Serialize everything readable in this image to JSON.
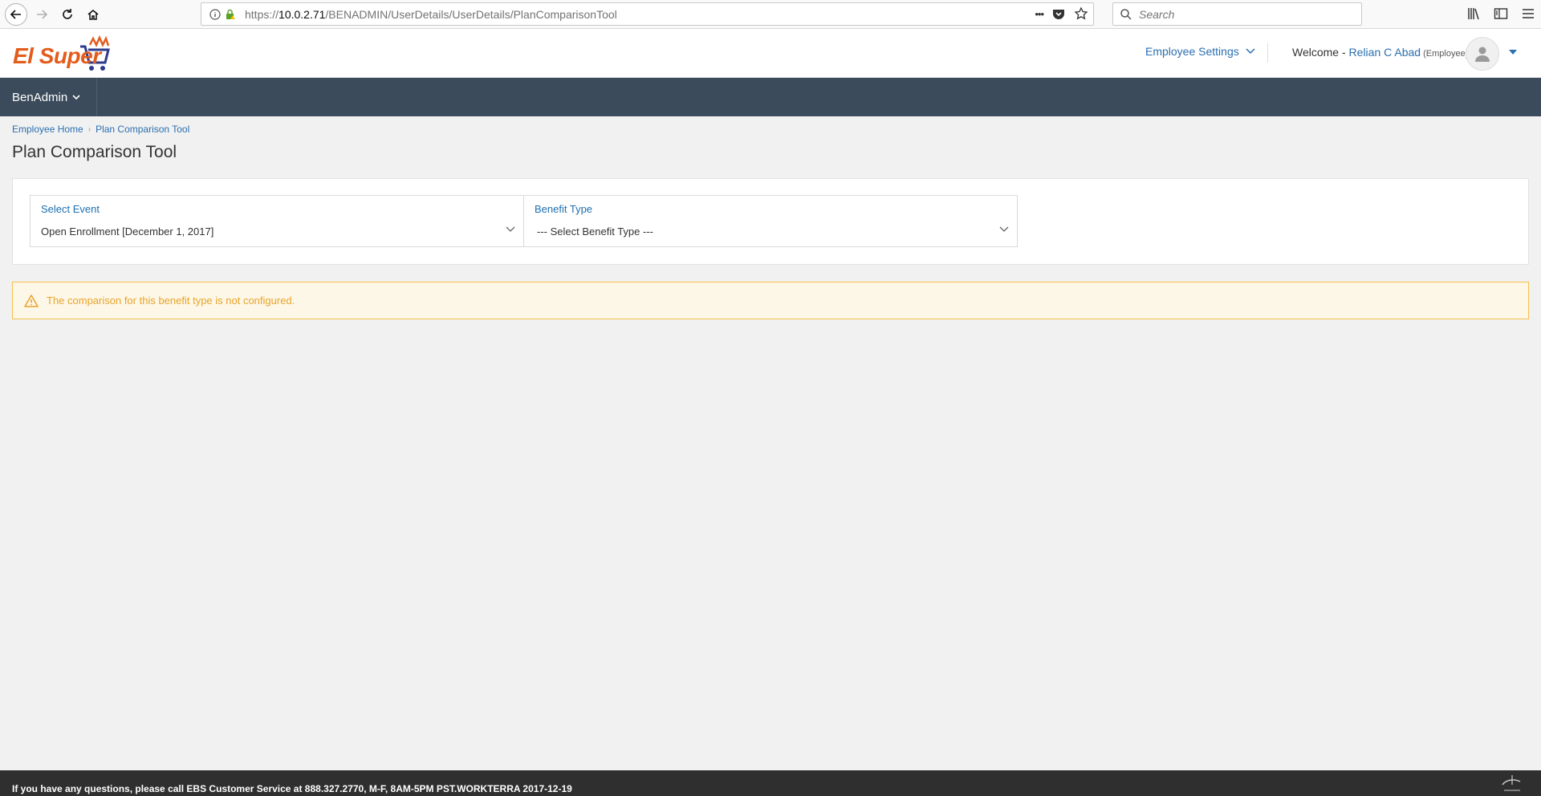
{
  "browser": {
    "url_prefix": "https://",
    "url_host": "10.0.2.71",
    "url_path": "/BENADMIN/UserDetails/UserDetails/PlanComparisonTool",
    "search_placeholder": "Search",
    "more_label": "•••"
  },
  "header": {
    "logo_text": "El Super",
    "employee_settings": "Employee Settings",
    "welcome_prefix": "Welcome - ",
    "user_name": "Relian C Abad",
    "user_role": " (Employee)"
  },
  "nav": {
    "menu_label": "BenAdmin"
  },
  "breadcrumb": {
    "items": [
      "Employee Home",
      "Plan Comparison Tool"
    ]
  },
  "page": {
    "title": "Plan Comparison Tool"
  },
  "filters": {
    "event_label": "Select Event",
    "event_value": "Open Enrollment [December 1, 2017]",
    "benefit_label": "Benefit Type",
    "benefit_value": "--- Select Benefit Type ---"
  },
  "alert": {
    "message": "The comparison for this benefit type is not configured."
  },
  "footer": {
    "text": "If you have any questions, please call EBS Customer Service at 888.327.2770, M-F, 8AM-5PM PST.WORKTERRA 2017-12-19"
  },
  "colors": {
    "navbar": "#3b4b5b",
    "link": "#2a6fb0",
    "logo": "#e35c1c",
    "alert_bg": "#fdf7e7",
    "alert_border": "#f5c04c",
    "alert_text": "#e8a42a",
    "footer_bg": "#2f2f2f"
  },
  "icons": {
    "back": "back-arrow-icon",
    "forward": "forward-arrow-icon",
    "reload": "reload-icon",
    "home": "home-icon",
    "info": "info-icon",
    "lock": "lock-icon",
    "pocket": "pocket-icon",
    "bookmark": "star-icon",
    "library": "library-icon",
    "sidebar": "sidebar-icon",
    "menu": "hamburger-menu-icon",
    "warning": "warning-icon",
    "avatar": "user-avatar-icon"
  }
}
